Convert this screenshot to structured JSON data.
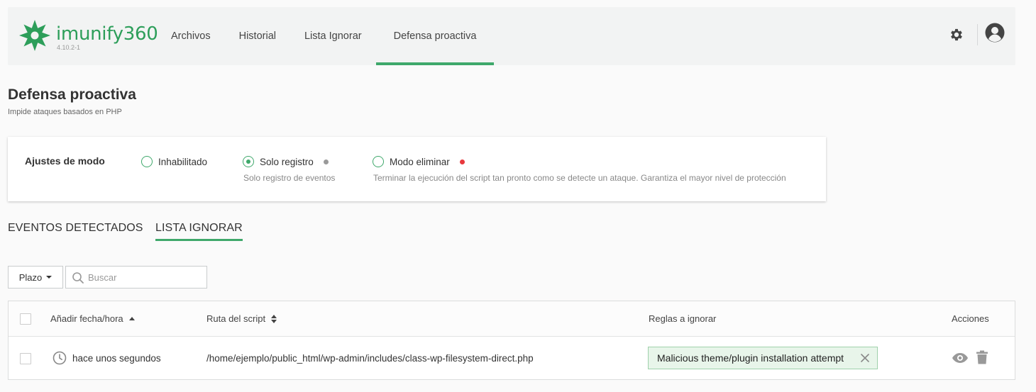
{
  "header": {
    "logo_text": "imunify360",
    "version": "4.10.2-1",
    "nav": [
      "Archivos",
      "Historial",
      "Lista Ignorar",
      "Defensa proactiva"
    ],
    "active_nav": "Defensa proactiva"
  },
  "page": {
    "title": "Defensa proactiva",
    "subtitle": "Impide ataques basados en PHP"
  },
  "mode": {
    "label": "Ajustes de modo",
    "options": [
      {
        "label": "Inhabilitado",
        "checked": false,
        "desc": ""
      },
      {
        "label": "Solo registro",
        "checked": true,
        "desc": "Solo registro de eventos",
        "dot_color": "#9a9a9a"
      },
      {
        "label": "Modo eliminar",
        "checked": false,
        "desc": "Terminar la ejecución del script tan pronto como se detecte un ataque. Garantiza el mayor nivel de protección",
        "dot_color": "#e8383d"
      }
    ]
  },
  "tabs": [
    "EVENTOS DETECTADOS",
    "LISTA IGNORAR"
  ],
  "active_tab": "LISTA IGNORAR",
  "filters": {
    "plazo_label": "Plazo",
    "search_placeholder": "Buscar"
  },
  "table": {
    "columns": [
      "Añadir fecha/hora",
      "Ruta del script",
      "Reglas a ignorar",
      "Acciones"
    ],
    "rows": [
      {
        "time": "hace unos segundos",
        "path": "/home/ejemplo/public_html/wp-admin/includes/class-wp-filesystem-direct.php",
        "rule": "Malicious theme/plugin installation attempt"
      }
    ]
  },
  "colors": {
    "accent": "#3fa86b",
    "header_bg": "#f2f3f3",
    "tag_bg": "#e8f5ea"
  }
}
